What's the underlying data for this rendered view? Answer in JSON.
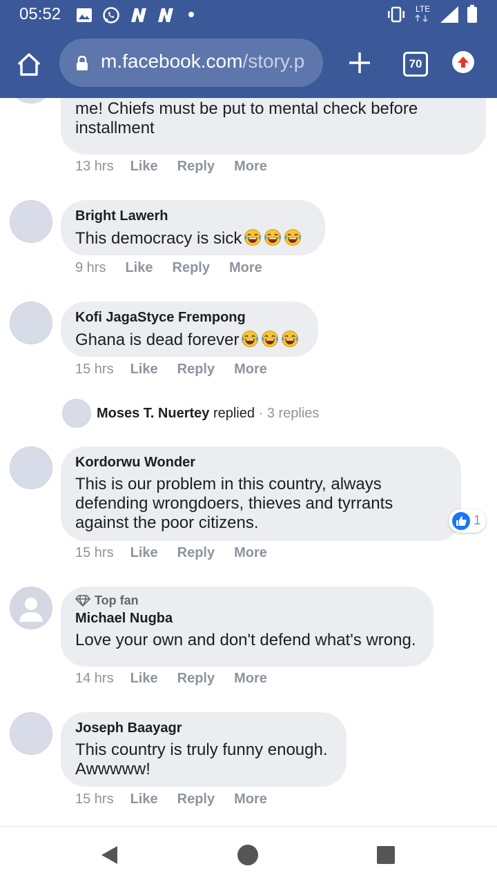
{
  "status_bar": {
    "time": "05:52",
    "network_label": "LTE",
    "icons": [
      "image-icon",
      "whatsapp-icon",
      "n-app-icon",
      "n-app-icon",
      "dot-icon",
      "vibrate-icon",
      "signal-icon",
      "battery-icon"
    ]
  },
  "browser": {
    "url_host": "m.facebook.com",
    "url_path": "/story.p",
    "tab_count": "70"
  },
  "comments": [
    {
      "name": "",
      "text": "Exhibition of sheer stupidity and insanity. Gracious me! Chiefs must be put to mental check before installment",
      "time": "13 hrs"
    },
    {
      "name": "Bright Lawerh",
      "text": "This democracy is sick",
      "emoji_count": 3,
      "time": "9 hrs"
    },
    {
      "name": "Kofi JagaStyce Frempong",
      "text": "Ghana is dead forever",
      "emoji_count": 3,
      "time": "15 hrs",
      "replies": {
        "name": "Moses T. Nuertey",
        "verb": "replied",
        "count": "· 3 replies"
      }
    },
    {
      "name": "Kordorwu Wonder",
      "text": "This is our problem in this country, always defending wrongdoers, thieves and tyrrants against the poor citizens.",
      "time": "15 hrs",
      "reaction_count": "1"
    },
    {
      "badge": "Top fan",
      "name": "Michael Nugba",
      "text": "Love your own and don't defend what's wrong.",
      "time": "14 hrs"
    },
    {
      "name": "Joseph Baayagr",
      "text": "This country is truly funny enough. Awwwww!",
      "time": "15 hrs"
    }
  ],
  "actions": {
    "like": "Like",
    "reply": "Reply",
    "more": "More"
  },
  "colors": {
    "brand": "#3b5998",
    "bubble": "#ebedf0",
    "meta": "#8d949e",
    "like_blue": "#1877f2"
  },
  "nav_icons": [
    "back-icon",
    "home-circle-icon",
    "recents-icon"
  ]
}
